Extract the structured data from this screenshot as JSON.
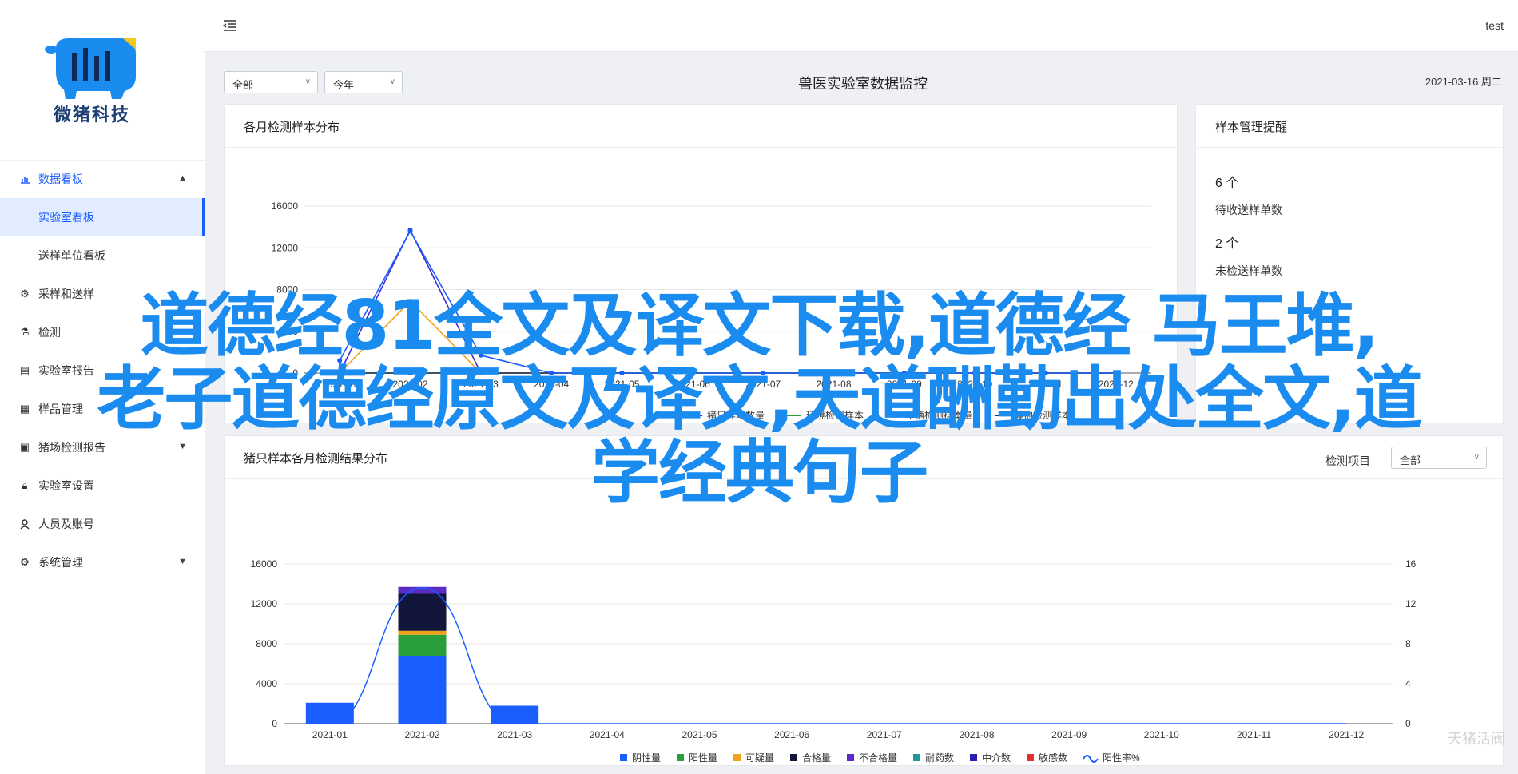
{
  "app": {
    "brand": "微猪科技",
    "user": "test"
  },
  "sidebar": {
    "items": [
      {
        "label": "数据看板",
        "icon": "bar-chart-icon"
      },
      {
        "label": "实验室看板"
      },
      {
        "label": "送样单位看板"
      },
      {
        "label": "采样和送样",
        "icon": "gear-cluster-icon"
      },
      {
        "label": "检测",
        "icon": "flask-icon"
      },
      {
        "label": "实验室报告",
        "icon": "document-icon"
      },
      {
        "label": "样品管理",
        "icon": "grid-icon"
      },
      {
        "label": "猪场检测报告",
        "icon": "clipboard-icon"
      },
      {
        "label": "实验室设置",
        "icon": "lock-icon"
      },
      {
        "label": "人员及账号",
        "icon": "user-icon"
      },
      {
        "label": "系统管理",
        "icon": "settings-icon"
      }
    ]
  },
  "filters": {
    "scope": "全部",
    "period": "今年"
  },
  "page": {
    "title": "兽医实验室数据监控",
    "date": "2021-03-16 周二"
  },
  "card1": {
    "title": "各月检测样本分布"
  },
  "card2": {
    "title": "样本管理提醒",
    "stats": [
      {
        "value": "6 个",
        "label": "待收送样单数"
      },
      {
        "value": "2 个",
        "label": "未检送样单数"
      }
    ]
  },
  "card3": {
    "title": "猪只样本各月检测结果分布",
    "filter_label": "检测项目",
    "filter_value": "全部"
  },
  "overlay": {
    "line1": "道德经81全文及译文下载,道德经 马王堆,",
    "line2": "老子道德经原文及译文,天道酬勤出处全文,道",
    "line3": "学经典句子"
  },
  "watermark": "天猪活阀",
  "chart_data": [
    {
      "type": "line",
      "title": "各月检测样本分布",
      "categories": [
        "2021-01",
        "2021-02",
        "2021-03",
        "2021-04",
        "2021-05",
        "2021-06",
        "2021-07",
        "2021-08",
        "2021-09",
        "2021-10",
        "2021-11",
        "2021-12"
      ],
      "yticks": [
        "0",
        "4000",
        "8000",
        "12000",
        "16000"
      ],
      "ylim": [
        0,
        16000
      ],
      "series": [
        {
          "name": "猪只样本数量",
          "color": "#3b2bd6",
          "values": [
            0,
            13700,
            0,
            0,
            0,
            0,
            0,
            0,
            0,
            0,
            0,
            0
          ]
        },
        {
          "name": "环境检测样本",
          "color": "#2a9e3a",
          "values": [
            0,
            0,
            0,
            0,
            0,
            0,
            0,
            0,
            0,
            0,
            0,
            0
          ]
        },
        {
          "name": "车辆检测样本量",
          "color": "#f0a21a",
          "values": [
            0,
            6900,
            0,
            0,
            0,
            0,
            0,
            0,
            0,
            0,
            0,
            0
          ]
        },
        {
          "name": "其他检测样本",
          "color": "#1f2a5a",
          "values": [
            0,
            0,
            0,
            0,
            0,
            0,
            0,
            0,
            0,
            0,
            0,
            0
          ]
        },
        {
          "name": "",
          "color": "#1a5eff",
          "values": [
            1200,
            13600,
            1700,
            0,
            0,
            0,
            0,
            0,
            0,
            0,
            0,
            0
          ]
        }
      ]
    },
    {
      "type": "bar",
      "title": "猪只样本各月检测结果分布",
      "categories": [
        "2021-01",
        "2021-02",
        "2021-03",
        "2021-04",
        "2021-05",
        "2021-06",
        "2021-07",
        "2021-08",
        "2021-09",
        "2021-10",
        "2021-11",
        "2021-12"
      ],
      "yticks": [
        "0",
        "4000",
        "8000",
        "12000",
        "16000"
      ],
      "y2ticks": [
        "0",
        "4",
        "8",
        "12",
        "16"
      ],
      "ylim": [
        0,
        16000
      ],
      "y2lim": [
        0,
        16
      ],
      "stacked": true,
      "series": [
        {
          "name": "阴性量",
          "color": "#1a5eff",
          "values": [
            2100,
            6800,
            1800,
            0,
            0,
            0,
            0,
            0,
            0,
            0,
            0,
            0
          ]
        },
        {
          "name": "阳性量",
          "color": "#2a9e3a",
          "values": [
            0,
            2100,
            0,
            0,
            0,
            0,
            0,
            0,
            0,
            0,
            0,
            0
          ]
        },
        {
          "name": "可疑量",
          "color": "#f0a21a",
          "values": [
            0,
            400,
            0,
            0,
            0,
            0,
            0,
            0,
            0,
            0,
            0,
            0
          ]
        },
        {
          "name": "合格量",
          "color": "#12163a",
          "values": [
            0,
            3700,
            0,
            0,
            0,
            0,
            0,
            0,
            0,
            0,
            0,
            0
          ]
        },
        {
          "name": "不合格量",
          "color": "#5b2bc6",
          "values": [
            0,
            700,
            0,
            0,
            0,
            0,
            0,
            0,
            0,
            0,
            0,
            0
          ]
        },
        {
          "name": "耐药数",
          "color": "#1a9aa0",
          "values": [
            0,
            0,
            0,
            0,
            0,
            0,
            0,
            0,
            0,
            0,
            0,
            0
          ]
        },
        {
          "name": "中介数",
          "color": "#2a1fb0",
          "values": [
            0,
            0,
            0,
            0,
            0,
            0,
            0,
            0,
            0,
            0,
            0,
            0
          ]
        },
        {
          "name": "敏感数",
          "color": "#e03030",
          "values": [
            0,
            0,
            0,
            0,
            0,
            0,
            0,
            0,
            0,
            0,
            0,
            0
          ]
        }
      ],
      "line_series": {
        "name": "阳性率%",
        "color": "#1a5eff",
        "values": [
          0,
          13.6,
          0,
          0,
          0,
          0,
          0,
          0,
          0,
          0,
          0,
          0
        ]
      }
    }
  ]
}
